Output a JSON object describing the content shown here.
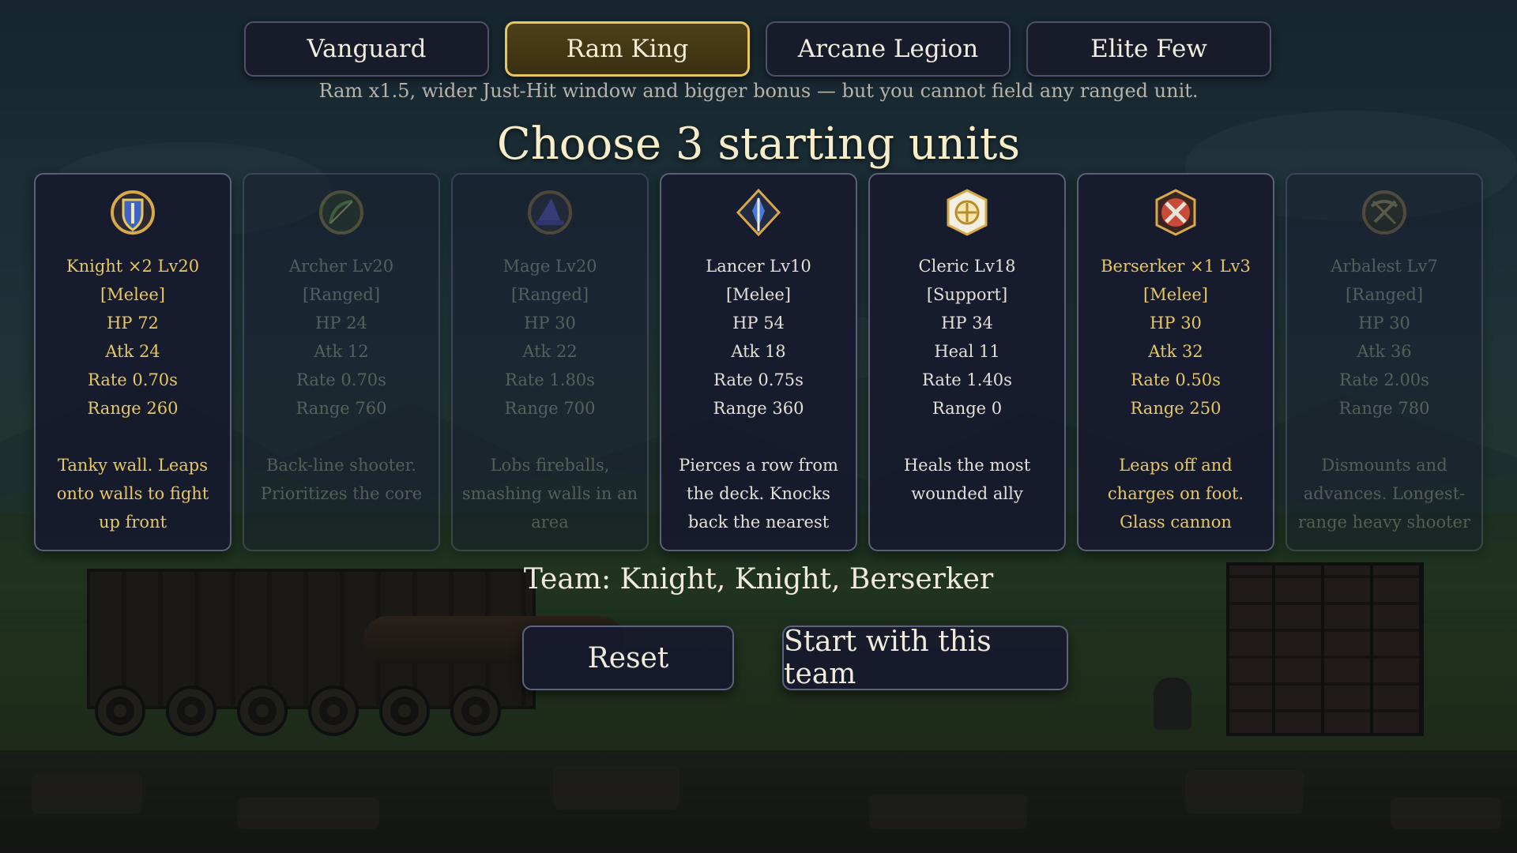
{
  "tabs": [
    {
      "label": "Vanguard",
      "active": false
    },
    {
      "label": "Ram King",
      "active": true
    },
    {
      "label": "Arcane Legion",
      "active": false
    },
    {
      "label": "Elite Few",
      "active": false
    }
  ],
  "mode_description": "Ram x1.5, wider Just-Hit window and bigger bonus — but you cannot field any ranged unit.",
  "heading": "Choose 3 starting units",
  "units": [
    {
      "name_line": "Knight  ×2  Lv20",
      "role": "[Melee]",
      "hp": "HP 72",
      "power": "Atk 24",
      "rate": "Rate 0.70s",
      "range": "Range 260",
      "desc": "Tanky wall. Leaps onto walls to fight up front",
      "state": "selected",
      "icon": "knight-shield-icon",
      "color": "#e9c75e"
    },
    {
      "name_line": "Archer  Lv20",
      "role": "[Ranged]",
      "hp": "HP 24",
      "power": "Atk 12",
      "rate": "Rate 0.70s",
      "range": "Range 760",
      "desc": "Back-line shooter. Prioritizes the core",
      "state": "disabled",
      "icon": "archer-bow-icon",
      "color": "#6b9a4a"
    },
    {
      "name_line": "Mage  Lv20",
      "role": "[Ranged]",
      "hp": "HP 30",
      "power": "Atk 22",
      "rate": "Rate 1.80s",
      "range": "Range 700",
      "desc": "Lobs fireballs, smashing walls in an area",
      "state": "disabled",
      "icon": "mage-hat-icon",
      "color": "#5a4fc8"
    },
    {
      "name_line": "Lancer  Lv10",
      "role": "[Melee]",
      "hp": "HP 54",
      "power": "Atk 18",
      "rate": "Rate 0.75s",
      "range": "Range 360",
      "desc": "Pierces a row from the deck. Knocks back the nearest",
      "state": "normal",
      "icon": "lancer-spear-icon",
      "color": "#4a7ad8"
    },
    {
      "name_line": "Cleric  Lv18",
      "role": "[Support]",
      "hp": "HP 34",
      "power": "Heal 11",
      "rate": "Rate 1.40s",
      "range": "Range 0",
      "desc": "Heals the most wounded ally",
      "state": "normal",
      "icon": "cleric-holy-icon",
      "color": "#f2efe2"
    },
    {
      "name_line": "Berserker  ×1  Lv3",
      "role": "[Melee]",
      "hp": "HP 30",
      "power": "Atk 32",
      "rate": "Rate 0.50s",
      "range": "Range 250",
      "desc": "Leaps off and charges on foot. Glass cannon",
      "state": "selected",
      "icon": "berserker-axe-icon",
      "color": "#c84b3a"
    },
    {
      "name_line": "Arbalest  Lv7",
      "role": "[Ranged]",
      "hp": "HP 30",
      "power": "Atk 36",
      "rate": "Rate 2.00s",
      "range": "Range 780",
      "desc": "Dismounts and advances. Longest-range heavy shooter",
      "state": "disabled",
      "icon": "arbalest-crossbow-icon",
      "color": "#5a4a3a"
    }
  ],
  "team_text": "Team: Knight, Knight, Berserker",
  "buttons": {
    "reset": "Reset",
    "start": "Start with this team"
  }
}
